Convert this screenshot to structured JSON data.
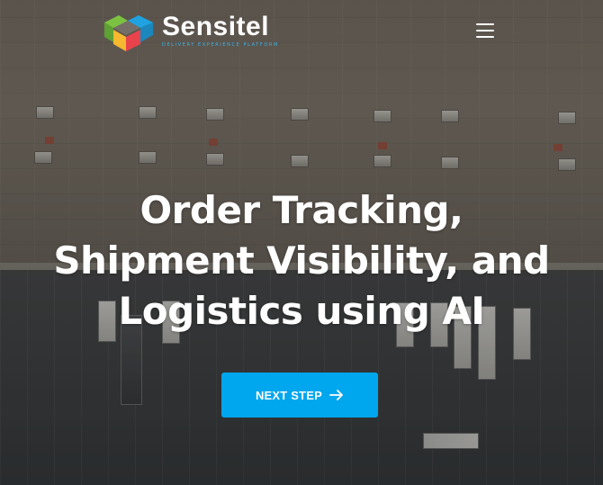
{
  "brand": {
    "name": "Sensitel",
    "tagline": "DELIVERY EXPERIENCE PLATFORM",
    "colors": {
      "green": "#7cc242",
      "blue": "#1fa2e0",
      "red": "#e8434b",
      "yellow": "#f5b82e"
    }
  },
  "header": {
    "menu_icon": "hamburger-menu-icon"
  },
  "hero": {
    "headline_lines": [
      "Order Tracking,",
      "Shipment Visibility, and",
      "Logistics using AI"
    ],
    "cta_label": "NEXT STEP",
    "cta_icon": "arrow-right-icon",
    "cta_color": "#00a6ee"
  }
}
